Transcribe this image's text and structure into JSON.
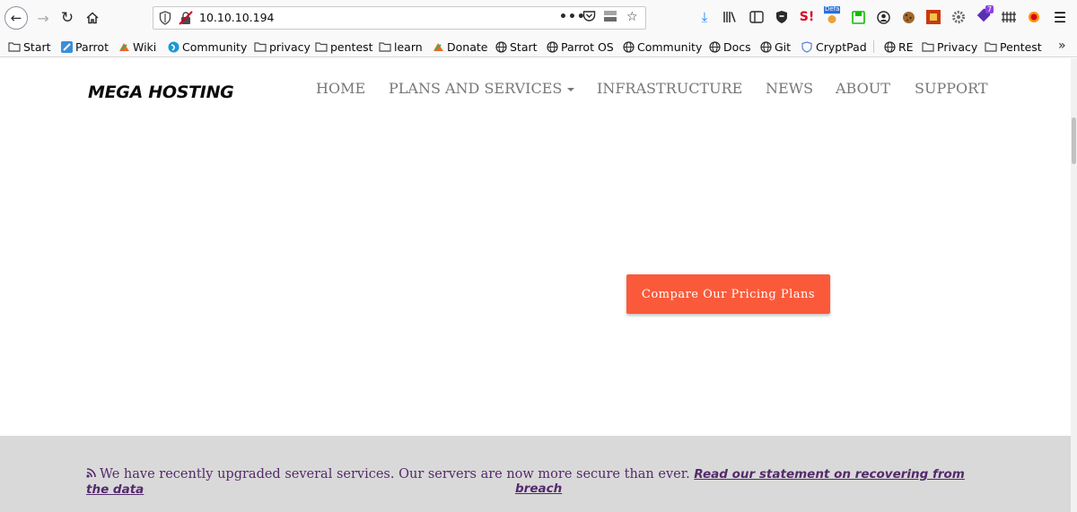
{
  "browser": {
    "url": "10.10.10.194",
    "ext_badges": {
      "defaults": "Defa",
      "count": "7"
    }
  },
  "bookmarks": [
    {
      "label": "Start",
      "icon": "folder-icon"
    },
    {
      "label": "Parrot",
      "icon": "parrot-icon"
    },
    {
      "label": "Wiki",
      "icon": "wiki-icon"
    },
    {
      "label": "Community",
      "icon": "community-icon"
    },
    {
      "label": "privacy",
      "icon": "folder-icon"
    },
    {
      "label": "pentest",
      "icon": "folder-icon"
    },
    {
      "label": "learn",
      "icon": "folder-icon"
    },
    {
      "label": "Donate",
      "icon": "donate-icon"
    },
    {
      "label": "Start",
      "icon": "globe-icon"
    },
    {
      "label": "Parrot OS",
      "icon": "globe-icon"
    },
    {
      "label": "Community",
      "icon": "globe-icon"
    },
    {
      "label": "Docs",
      "icon": "globe-icon"
    },
    {
      "label": "Git",
      "icon": "globe-icon"
    },
    {
      "label": "CryptPad",
      "icon": "shield-icon"
    },
    {
      "label": "RE",
      "icon": "globe-icon"
    },
    {
      "label": "Privacy",
      "icon": "folder-icon"
    },
    {
      "label": "Pentest",
      "icon": "folder-icon"
    }
  ],
  "site": {
    "logo": "MEGA HOSTING",
    "nav": {
      "home": "HOME",
      "plans": "PLANS AND SERVICES",
      "infrastructure": "INFRASTRUCTURE",
      "news": "NEWS",
      "about": "ABOUT",
      "support": "SUPPORT"
    },
    "cta": "Compare Our Pricing Plans",
    "banner": {
      "text": "We have recently upgraded several services. Our servers are now more secure than ever.",
      "link_part1": "Read our statement on recovering from the data",
      "link_part2": "breach"
    }
  },
  "colors": {
    "cta": "#fb5a3a",
    "banner_bg": "#d9d9d9",
    "banner_text": "#542a6b",
    "nav_text": "#777777"
  }
}
